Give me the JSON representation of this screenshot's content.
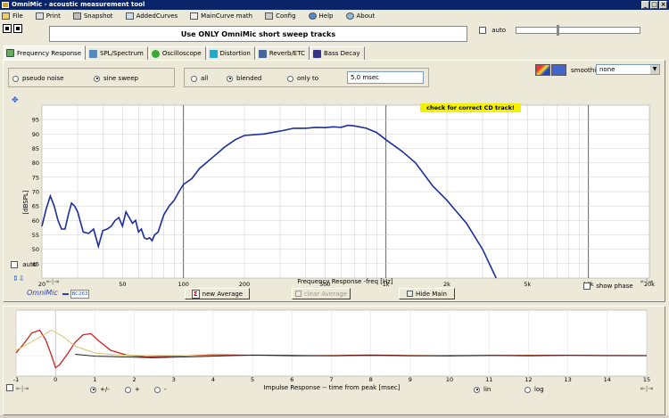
{
  "window": {
    "title": "OmniMic - acoustic measurement tool"
  },
  "menu": [
    {
      "label": "File",
      "icon": "folder-icon"
    },
    {
      "label": "Print",
      "icon": "printer-icon"
    },
    {
      "label": "Snapshot",
      "icon": "camera-icon"
    },
    {
      "label": "AddedCurves",
      "icon": "curves-icon"
    },
    {
      "label": "MainCurve math",
      "icon": "math-icon"
    },
    {
      "label": "Config",
      "icon": "wrench-icon"
    },
    {
      "label": "Help",
      "icon": "help-icon"
    },
    {
      "label": "About",
      "icon": "info-icon"
    }
  ],
  "notice": "Use ONLY OmniMic short sweep tracks",
  "top_auto_label": "auto",
  "tabs": [
    {
      "label": "Frequency Response",
      "active": true
    },
    {
      "label": "SPL/Spectrum"
    },
    {
      "label": "Oscilloscope"
    },
    {
      "label": "Distortion"
    },
    {
      "label": "Reverb/ETC"
    },
    {
      "label": "Bass Decay"
    }
  ],
  "source": {
    "pseudo_noise": "pseudo noise",
    "sine_sweep": "sine sweep",
    "selected": "sine sweep"
  },
  "window_mode": {
    "all": "all",
    "blended": "blended",
    "only_to": "only to",
    "selected": "blended",
    "msec_value": "5.0 msec"
  },
  "smoothing": {
    "label": "smoothing",
    "value": "none"
  },
  "warning": "check for correct CD track!",
  "fr_chart_controls": {
    "auto": "auto",
    "brand": "OmniMic",
    "mic_id": "BC263",
    "new_average": "new Average",
    "clear_average": "clear Average",
    "hide_main": "Hide Main",
    "show_phase": "show phase"
  },
  "ir_controls": {
    "plus_minus": "+/-",
    "plus": "+",
    "minus": "-",
    "lin": "lin",
    "log": "log",
    "polarity_selected": "+/-",
    "scale_selected": "lin"
  },
  "chart_data": [
    {
      "type": "line",
      "title": "",
      "xlabel": "Frequency Response -freq [Hz]",
      "ylabel": "[dBSPL]",
      "x_scale": "log",
      "xlim": [
        20,
        20000
      ],
      "ylim": [
        40,
        100
      ],
      "x_ticks": [
        20,
        50,
        100,
        200,
        500,
        1000,
        2000,
        5000,
        10000,
        20000
      ],
      "x_tick_labels": [
        "20",
        "50",
        "100",
        "200",
        "500",
        "1k",
        "2k",
        "5k",
        "10k",
        "20k"
      ],
      "y_ticks": [
        45,
        50,
        55,
        60,
        65,
        70,
        75,
        80,
        85,
        90,
        95
      ],
      "grid": true,
      "line_color": "#1c2d9c",
      "series": [
        {
          "x": [
            20,
            21,
            22,
            23,
            24,
            25,
            26,
            27,
            28,
            29,
            30,
            32,
            34,
            36,
            38,
            40,
            42,
            44,
            46,
            48,
            50,
            52,
            54,
            56,
            58,
            60,
            62,
            64,
            66,
            68,
            70,
            72,
            75,
            80,
            85,
            90,
            95,
            100,
            110,
            120,
            140,
            160,
            180,
            200,
            250,
            300,
            350,
            400,
            450,
            500,
            550,
            600,
            650,
            700,
            800,
            900,
            1000,
            1200,
            1400,
            1700,
            2000,
            2500,
            3000,
            3500
          ],
          "y": [
            58,
            64,
            68.5,
            65,
            60,
            57,
            57,
            62,
            66,
            65,
            63,
            56,
            55.5,
            57,
            51,
            56.5,
            57,
            58,
            60,
            61,
            58,
            63,
            61,
            59,
            60,
            56,
            57,
            54,
            53.5,
            54,
            53,
            55,
            56,
            62,
            65,
            67,
            70,
            72.5,
            74.5,
            78,
            82,
            85.5,
            88,
            89.5,
            90,
            91,
            92,
            92,
            92.3,
            92.2,
            92.5,
            92.3,
            93,
            92.8,
            92,
            90.5,
            88,
            84,
            80,
            72,
            67,
            59,
            50,
            40
          ]
        }
      ]
    },
    {
      "type": "line",
      "title": "",
      "xlabel": "Impulse Response  -- time from peak [msec]",
      "ylabel": "",
      "xlim": [
        -1,
        15
      ],
      "x_ticks": [
        -1,
        0,
        1,
        2,
        3,
        4,
        5,
        6,
        7,
        8,
        9,
        10,
        11,
        12,
        13,
        14,
        15
      ],
      "grid": true,
      "series": [
        {
          "name": "",
          "color": "#cc2222",
          "x": [
            -1,
            -0.8,
            -0.6,
            -0.4,
            -0.25,
            -0.1,
            0,
            0.1,
            0.3,
            0.5,
            0.7,
            0.9,
            1.1,
            1.4,
            1.8,
            2.3,
            3,
            4,
            6,
            8,
            10,
            12,
            15
          ],
          "y": [
            0.1,
            0.45,
            0.85,
            0.95,
            0.6,
            0.0,
            -0.45,
            -0.35,
            0.05,
            0.5,
            0.78,
            0.82,
            0.55,
            0.2,
            0.02,
            -0.05,
            -0.02,
            0.03,
            -0.01,
            0.02,
            -0.01,
            0.01,
            0.0
          ]
        },
        {
          "name": "",
          "color": "#d9c26a",
          "x": [
            -1,
            -0.5,
            -0.1,
            0.2,
            0.5,
            1.0,
            1.6,
            2.2,
            3,
            4,
            6,
            9,
            12,
            15
          ],
          "y": [
            0.2,
            0.6,
            0.95,
            0.7,
            0.35,
            0.1,
            0.02,
            0.0,
            0.0,
            0.0,
            0.0,
            0.0,
            0.0,
            0.0
          ]
        },
        {
          "name": "",
          "color": "#222222",
          "x": [
            0.5,
            1.0,
            1.5,
            2.0,
            2.5,
            3,
            3.5,
            4,
            4.5,
            5,
            6,
            7,
            8,
            9,
            10,
            11,
            12,
            13,
            14,
            15
          ],
          "y": [
            0.05,
            -0.02,
            -0.04,
            -0.06,
            -0.08,
            -0.06,
            -0.04,
            -0.02,
            0.0,
            0.02,
            0.01,
            -0.01,
            0.01,
            -0.01,
            0.0,
            0.01,
            -0.01,
            0.01,
            0.0,
            0.0
          ]
        }
      ]
    }
  ]
}
